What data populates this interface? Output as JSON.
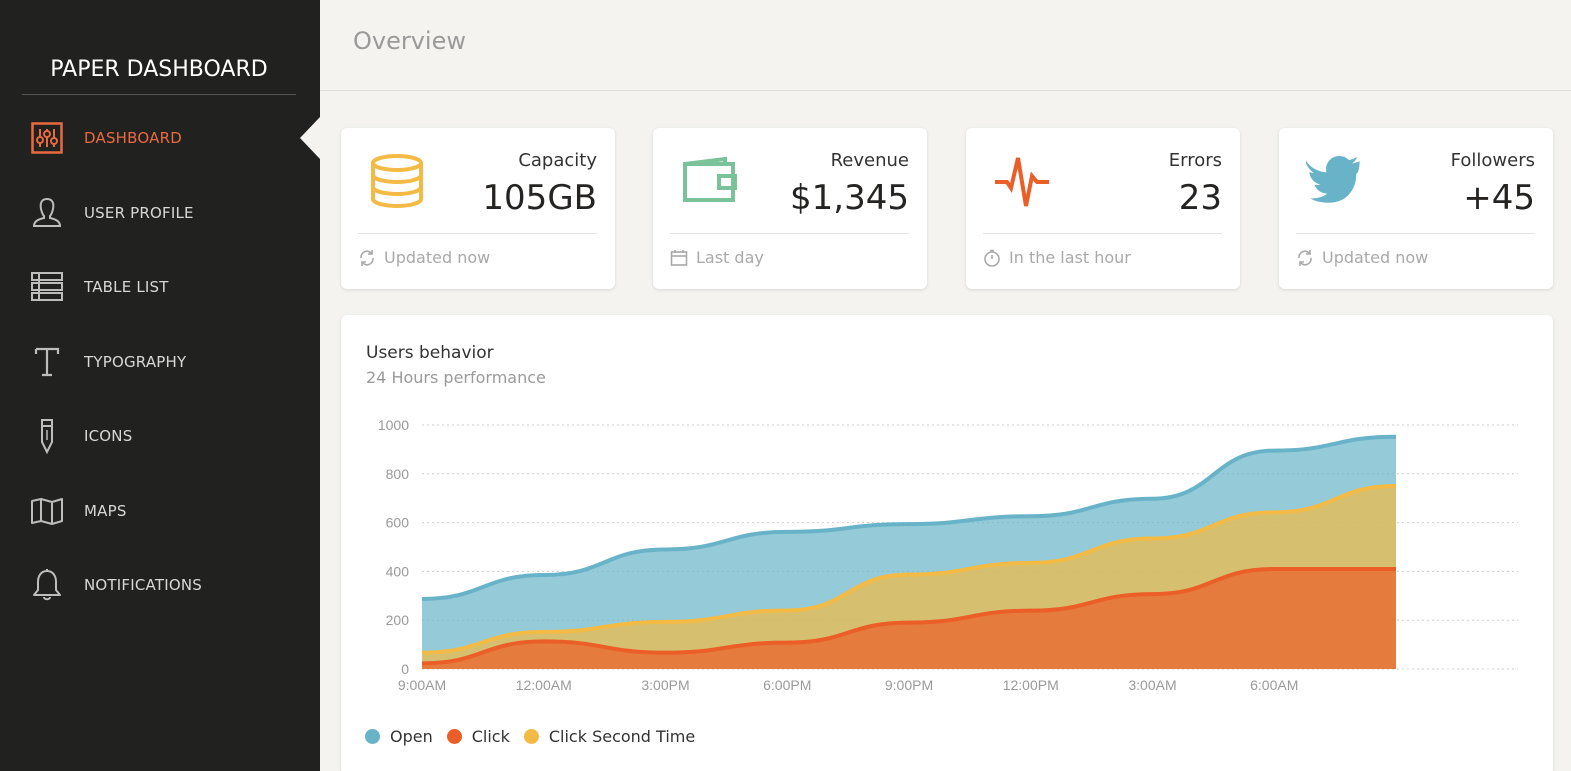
{
  "sidebar": {
    "brand": "PAPER DASHBOARD",
    "items": [
      {
        "label": "DASHBOARD",
        "icon": "sliders-icon",
        "active": true
      },
      {
        "label": "USER PROFILE",
        "icon": "user-icon",
        "active": false
      },
      {
        "label": "TABLE LIST",
        "icon": "table-list-icon",
        "active": false
      },
      {
        "label": "TYPOGRAPHY",
        "icon": "typography-icon",
        "active": false
      },
      {
        "label": "ICONS",
        "icon": "pencil-icon",
        "active": false
      },
      {
        "label": "MAPS",
        "icon": "map-icon",
        "active": false
      },
      {
        "label": "NOTIFICATIONS",
        "icon": "bell-icon",
        "active": false
      }
    ]
  },
  "header": {
    "title": "Overview"
  },
  "stats": [
    {
      "label": "Capacity",
      "value": "105GB",
      "footer": "Updated now",
      "icon": "database-icon",
      "footer_icon": "refresh-icon",
      "color": "#f3bb45"
    },
    {
      "label": "Revenue",
      "value": "$1,345",
      "footer": "Last day",
      "icon": "wallet-icon",
      "footer_icon": "calendar-icon",
      "color": "#7ac29a"
    },
    {
      "label": "Errors",
      "value": "23",
      "footer": "In the last hour",
      "icon": "pulse-icon",
      "footer_icon": "timer-icon",
      "color": "#eb5e28"
    },
    {
      "label": "Followers",
      "value": "+45",
      "footer": "Updated now",
      "icon": "twitter-icon",
      "footer_icon": "refresh-icon",
      "color": "#68b3c8"
    }
  ],
  "chart_card": {
    "title": "Users behavior",
    "subtitle": "24 Hours performance"
  },
  "chart_data": {
    "type": "area",
    "categories": [
      "9:00AM",
      "12:00AM",
      "3:00PM",
      "6:00PM",
      "9:00PM",
      "12:00PM",
      "3:00AM",
      "6:00AM"
    ],
    "x": [
      0,
      1,
      2,
      3,
      4,
      5,
      6,
      7,
      8
    ],
    "ylim": [
      0,
      1000
    ],
    "yticks": [
      0,
      200,
      400,
      600,
      800,
      1000
    ],
    "grid": true,
    "legend_position": "bottom",
    "series": [
      {
        "name": "Open",
        "color": "#68b3c8",
        "values": [
          287,
          385,
          490,
          562,
          594,
          626,
          698,
          895,
          952
        ]
      },
      {
        "name": "Click Second Time",
        "color": "#f3bb45",
        "values": [
          67,
          152,
          193,
          240,
          387,
          435,
          535,
          642,
          750
        ]
      },
      {
        "name": "Click",
        "color": "#eb5e28",
        "values": [
          23,
          113,
          67,
          108,
          190,
          239,
          307,
          410,
          410
        ]
      }
    ],
    "legend_order": [
      "Open",
      "Click",
      "Click Second Time"
    ]
  }
}
